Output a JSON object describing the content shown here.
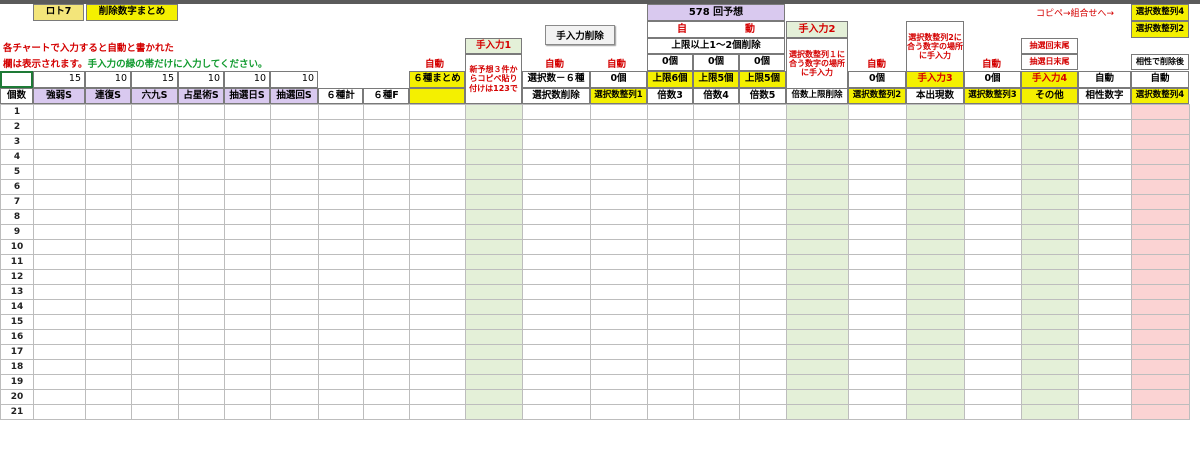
{
  "sheet": {
    "loto_label": "ロト7",
    "summary_label": "削除数字まとめ",
    "forecast_label": "578 回予想",
    "copy_label": "コピペ→組合せへ→",
    "manual_delete_button": "手入力削除"
  },
  "notes": {
    "line1": "各チャートで入力すると自動と書かれた",
    "line2_red": "欄は表示されます。",
    "line2_green": "手入力の緑の帯だけに入力してください。"
  },
  "auto_label": "自動",
  "manual": {
    "m1": "手入力1",
    "m2": "手入力2",
    "m3": "手入力3",
    "m4": "手入力4"
  },
  "auto_split": {
    "left": "自",
    "right": "動"
  },
  "upper_limit_delete": "上限以上1～2個削除",
  "zero_count": "0個",
  "notes_boxes": {
    "new_forecast": "新予想３件からコピペ貼り付けは123で",
    "sel1_note": "選択数整列１に合う数字の場所に手入力",
    "sel2_note": "選択数整列2に合う数字の場所に手入力",
    "last_digit1": "抽選回末尾",
    "last_digit2": "抽選日末尾",
    "affinity": "相性で削除後"
  },
  "row3": {
    "vals": [
      "15",
      "10",
      "15",
      "10",
      "10",
      "10"
    ],
    "six_summary": "６種まとめ",
    "sel_minus6": "選択数－６種",
    "limit6": "上限6個",
    "limit5a": "上限5個",
    "limit5b": "上限5個"
  },
  "headers": {
    "count": "個数",
    "strong_weak": "強弱S",
    "consecutive": "連復S",
    "rokukyu": "六九S",
    "astrology": "占星術S",
    "draw_day": "抽選日S",
    "draw_round": "抽選回S",
    "six_total": "６種計",
    "six_f": "６種F",
    "sel_delete": "選択数削除",
    "sel_align1": "選択数整列1",
    "mult3": "倍数3",
    "mult4": "倍数4",
    "mult5": "倍数5",
    "mult_upper": "倍数上限削除",
    "sel_align2": "選択数整列2",
    "unseen": "本出現数",
    "sel_align3": "選択数整列3",
    "other": "その他",
    "affinity_num": "相性数字",
    "sel_align4": "選択数整列4"
  },
  "right_col": {
    "a4": "選択数整列4",
    "a2": "選択数整列2"
  },
  "rows": [
    "1",
    "2",
    "3",
    "4",
    "5",
    "6",
    "7",
    "8",
    "9",
    "10",
    "11",
    "12",
    "13",
    "14",
    "15",
    "16",
    "17",
    "18",
    "19",
    "20",
    "21"
  ]
}
